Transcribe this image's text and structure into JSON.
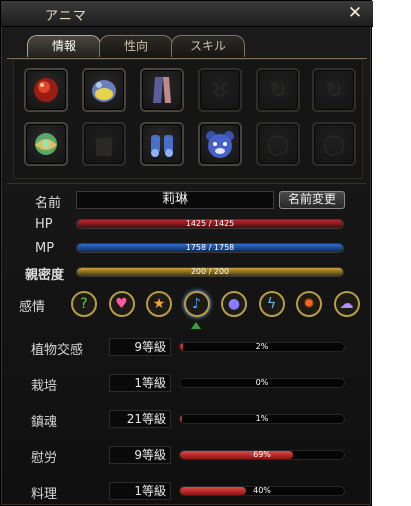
{
  "window": {
    "title": "アニマ",
    "close_glyph": "✕"
  },
  "tabs": [
    {
      "label": "情報",
      "active": true
    },
    {
      "label": "性向",
      "active": false
    },
    {
      "label": "スキル",
      "active": false
    }
  ],
  "equipment": {
    "row1": [
      {
        "icon": "red-gem-icon",
        "filled": true
      },
      {
        "icon": "egg-orb-icon",
        "filled": true
      },
      {
        "icon": "leg-armor-icon",
        "filled": true
      },
      {
        "icon": "accessory-empty-icon",
        "filled": false
      },
      {
        "icon": "ring-empty-icon",
        "filled": false
      },
      {
        "icon": "ring-empty-icon",
        "filled": false
      }
    ],
    "row2": [
      {
        "icon": "leaf-orb-icon",
        "filled": true
      },
      {
        "icon": "armor-empty-icon",
        "filled": false
      },
      {
        "icon": "blue-boots-icon",
        "filled": true
      },
      {
        "icon": "bear-head-icon",
        "filled": true
      },
      {
        "icon": "bracelet-empty-icon",
        "filled": false
      },
      {
        "icon": "bracelet-empty-icon",
        "filled": false
      }
    ]
  },
  "stats": {
    "name_label": "名前",
    "name_value": "莉琳",
    "rename_label": "名前変更",
    "hp_label": "HP",
    "hp_text": "1425 / 1425",
    "hp_ratio": 1.0,
    "mp_label": "MP",
    "mp_text": "1758 / 1758",
    "mp_ratio": 1.0,
    "intimacy_label": "親密度",
    "intimacy_text": "200 / 200",
    "intimacy_ratio": 1.0,
    "hp_color": "#c0262e",
    "mp_color": "#2f6fd6",
    "intimacy_color": "#c9a233"
  },
  "emotion": {
    "label": "感情",
    "icons": [
      {
        "name": "question-emotion-icon",
        "glyph": "?",
        "color": "#5fcf4a"
      },
      {
        "name": "heart-emotion-icon",
        "glyph": "♥",
        "color": "#ff5aa0"
      },
      {
        "name": "star-emotion-icon",
        "glyph": "★",
        "color": "#f0a640"
      },
      {
        "name": "music-emotion-icon",
        "glyph": "♪",
        "color": "#4fa0ff"
      },
      {
        "name": "shadow-emotion-icon",
        "glyph": "●",
        "color": "#8a7aff"
      },
      {
        "name": "lightning-emotion-icon",
        "glyph": "ϟ",
        "color": "#6fb8ff"
      },
      {
        "name": "fire-emotion-icon",
        "glyph": "✹",
        "color": "#ff6a1a"
      },
      {
        "name": "ghost-emotion-icon",
        "glyph": "☁",
        "color": "#b28cff"
      }
    ],
    "selected_index": 3
  },
  "skills": [
    {
      "name": "植物交感",
      "level": "9等級",
      "progress_text": "2%",
      "ratio": 0.02
    },
    {
      "name": "栽培",
      "level": "1等級",
      "progress_text": "0%",
      "ratio": 0.0
    },
    {
      "name": "鎮魂",
      "level": "21等級",
      "progress_text": "1%",
      "ratio": 0.01
    },
    {
      "name": "慰労",
      "level": "9等級",
      "progress_text": "69%",
      "ratio": 0.69
    },
    {
      "name": "料理",
      "level": "1等級",
      "progress_text": "40%",
      "ratio": 0.4
    }
  ]
}
